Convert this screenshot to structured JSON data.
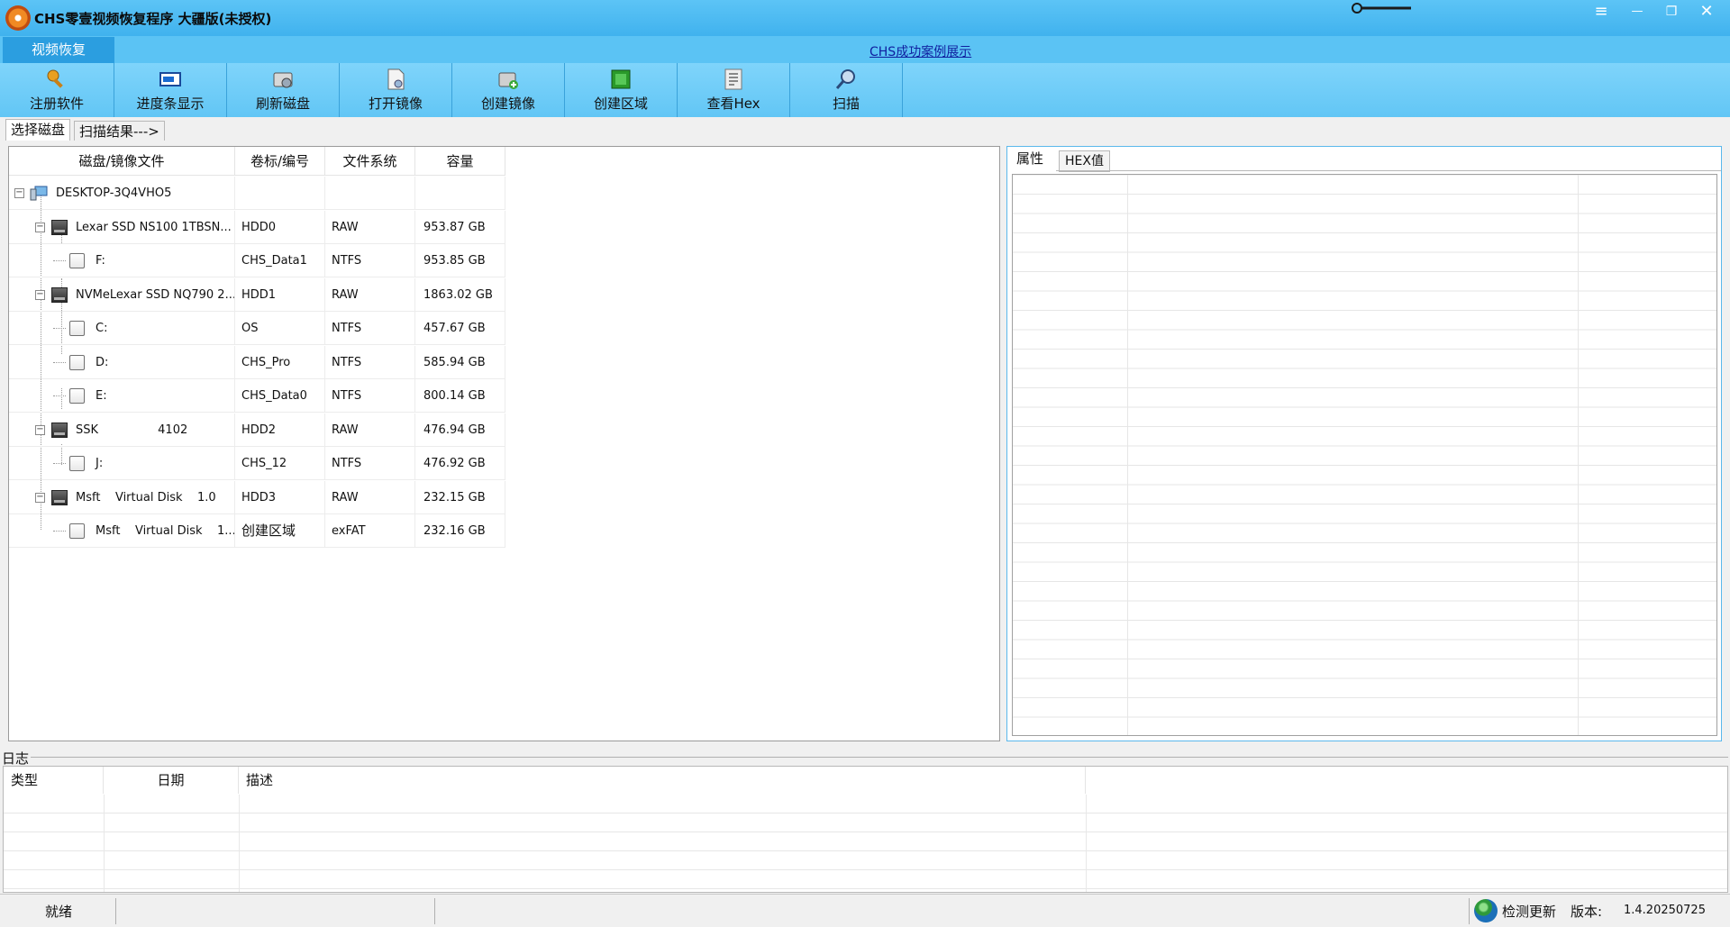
{
  "window": {
    "title": "CHS零壹视频恢复程序 大疆版(未授权)",
    "controls": [
      "≡",
      "—",
      "❐",
      "✕"
    ]
  },
  "ribbon": {
    "active_tab": "视频恢复",
    "link": "CHS成功案例展示"
  },
  "toolbar": {
    "items": [
      {
        "label": "注册软件",
        "icon": "key-register-icon"
      },
      {
        "label": "进度条显示",
        "icon": "progress-display-icon"
      },
      {
        "label": "刷新磁盘",
        "icon": "refresh-disk-icon"
      },
      {
        "label": "打开镜像",
        "icon": "open-image-icon"
      },
      {
        "label": "创建镜像",
        "icon": "create-image-icon"
      },
      {
        "label": "创建区域",
        "icon": "create-region-icon"
      },
      {
        "label": "查看Hex",
        "icon": "view-hex-icon"
      },
      {
        "label": "扫描",
        "icon": "scan-icon"
      }
    ]
  },
  "subtabs": {
    "select_disk": "选择磁盘",
    "scan_result": "扫描结果--->"
  },
  "disk_table": {
    "columns": [
      "磁盘/镜像文件",
      "卷标/编号",
      "文件系统",
      "容量"
    ],
    "rows": [
      {
        "name": "DESKTOP-3Q4VHO5",
        "vol": "",
        "fs": "",
        "cap": "",
        "level": 0,
        "kind": "computer"
      },
      {
        "name": "Lexar SSD NS100 1TBSN...",
        "vol": "HDD0",
        "fs": "RAW",
        "cap": "953.87 GB",
        "level": 1,
        "kind": "disk"
      },
      {
        "name": "F:",
        "vol": "CHS_Data1",
        "fs": "NTFS",
        "cap": "953.85 GB",
        "level": 2,
        "kind": "volume"
      },
      {
        "name": "NVMeLexar SSD NQ790 2...",
        "vol": "HDD1",
        "fs": "RAW",
        "cap": "1863.02 GB",
        "level": 1,
        "kind": "disk"
      },
      {
        "name": "C:",
        "vol": "OS",
        "fs": "NTFS",
        "cap": "457.67 GB",
        "level": 2,
        "kind": "volume"
      },
      {
        "name": "D:",
        "vol": "CHS_Pro",
        "fs": "NTFS",
        "cap": "585.94 GB",
        "level": 2,
        "kind": "volume"
      },
      {
        "name": "E:",
        "vol": "CHS_Data0",
        "fs": "NTFS",
        "cap": "800.14 GB",
        "level": 2,
        "kind": "volume"
      },
      {
        "name": "SSK                4102",
        "vol": "HDD2",
        "fs": "RAW",
        "cap": "476.94 GB",
        "level": 1,
        "kind": "disk"
      },
      {
        "name": "J:",
        "vol": "CHS_12",
        "fs": "NTFS",
        "cap": "476.92 GB",
        "level": 2,
        "kind": "volume"
      },
      {
        "name": "Msft    Virtual Disk    1.0",
        "vol": "HDD3",
        "fs": "RAW",
        "cap": "232.15 GB",
        "level": 1,
        "kind": "disk"
      },
      {
        "name": "Msft    Virtual Disk    1...",
        "vol": "创建区域",
        "fs": "exFAT",
        "cap": "232.16 GB",
        "level": 2,
        "kind": "volume"
      }
    ]
  },
  "property_panel": {
    "tab_attr": "属性",
    "tab_hex": "HEX值"
  },
  "log": {
    "label": "日志",
    "columns": [
      "类型",
      "日期",
      "描述"
    ]
  },
  "statusbar": {
    "status": "就绪",
    "check_update": "检测更新",
    "version_label": "版本:",
    "version": "1.4.20250725"
  },
  "colors": {
    "titlebar": "#40b2ee",
    "ribbon_tab_active": "#2b9ee0",
    "toolbar": "#7fd4fb",
    "link": "#1020a0"
  }
}
